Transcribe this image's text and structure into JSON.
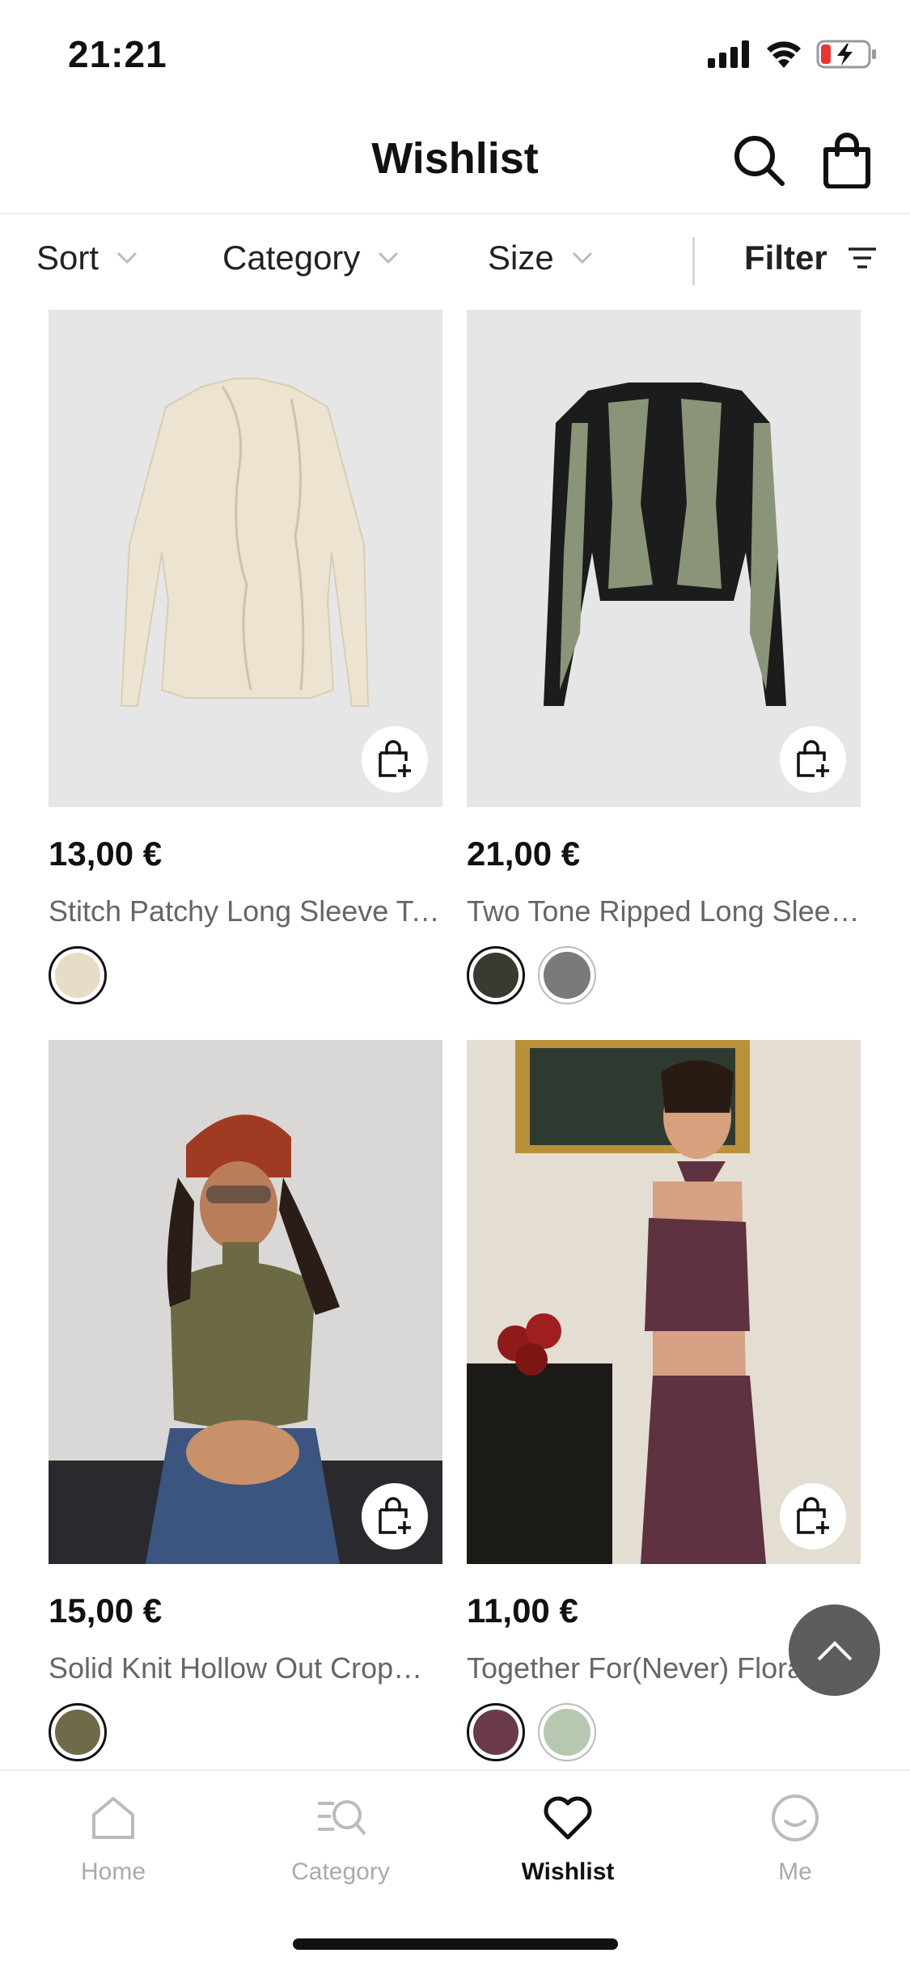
{
  "status_bar": {
    "time": "21:21"
  },
  "header": {
    "title": "Wishlist"
  },
  "filters": {
    "sort": "Sort",
    "category": "Category",
    "size": "Size",
    "filter": "Filter"
  },
  "products": [
    {
      "price": "13,00 €",
      "name": "Stitch Patchy Long Sleeve Tee",
      "image_desc": "cream long sleeve tee",
      "swatches": [
        "#e8dcc6"
      ]
    },
    {
      "price": "21,00 €",
      "name": "Two Tone Ripped Long Slee…",
      "image_desc": "green and black knit top",
      "swatches": [
        "#3a3a33",
        "#7a7a7a"
      ]
    },
    {
      "price": "15,00 €",
      "name": "Solid Knit Hollow Out Crop…",
      "image_desc": "olive knit crop top",
      "swatches": [
        "#6f6a4a"
      ]
    },
    {
      "price": "11,00 €",
      "name": "Together For(Never) Floral…",
      "image_desc": "plum floral set",
      "swatches": [
        "#6b3a48",
        "#b8c8b0"
      ]
    }
  ],
  "tabs": [
    {
      "label": "Home",
      "icon": "home-icon"
    },
    {
      "label": "Category",
      "icon": "category-icon"
    },
    {
      "label": "Wishlist",
      "icon": "heart-icon"
    },
    {
      "label": "Me",
      "icon": "smiley-icon"
    }
  ],
  "colors": {
    "accent": "#111111",
    "inactive": "#aaaaaa",
    "image_bg": "#e6e6e6"
  }
}
